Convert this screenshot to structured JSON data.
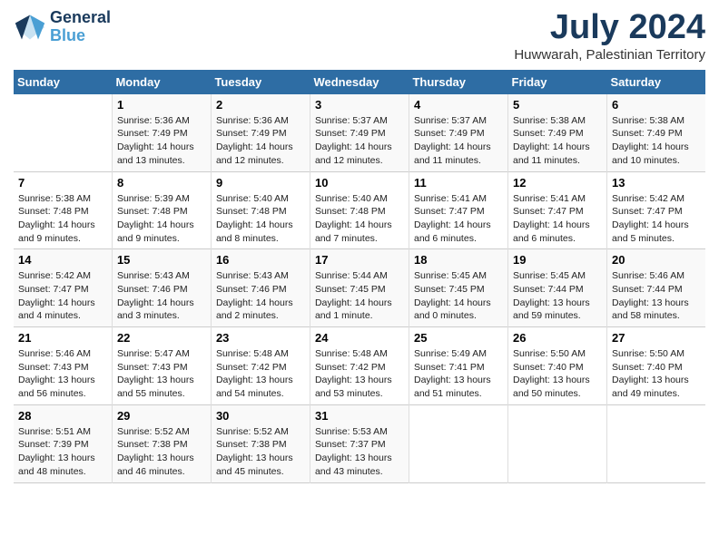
{
  "logo": {
    "text_general": "General",
    "text_blue": "Blue"
  },
  "title": "July 2024",
  "subtitle": "Huwwarah, Palestinian Territory",
  "days_header": [
    "Sunday",
    "Monday",
    "Tuesday",
    "Wednesday",
    "Thursday",
    "Friday",
    "Saturday"
  ],
  "weeks": [
    [
      {
        "day": "",
        "info": ""
      },
      {
        "day": "1",
        "info": "Sunrise: 5:36 AM\nSunset: 7:49 PM\nDaylight: 14 hours\nand 13 minutes."
      },
      {
        "day": "2",
        "info": "Sunrise: 5:36 AM\nSunset: 7:49 PM\nDaylight: 14 hours\nand 12 minutes."
      },
      {
        "day": "3",
        "info": "Sunrise: 5:37 AM\nSunset: 7:49 PM\nDaylight: 14 hours\nand 12 minutes."
      },
      {
        "day": "4",
        "info": "Sunrise: 5:37 AM\nSunset: 7:49 PM\nDaylight: 14 hours\nand 11 minutes."
      },
      {
        "day": "5",
        "info": "Sunrise: 5:38 AM\nSunset: 7:49 PM\nDaylight: 14 hours\nand 11 minutes."
      },
      {
        "day": "6",
        "info": "Sunrise: 5:38 AM\nSunset: 7:49 PM\nDaylight: 14 hours\nand 10 minutes."
      }
    ],
    [
      {
        "day": "7",
        "info": "Sunrise: 5:38 AM\nSunset: 7:48 PM\nDaylight: 14 hours\nand 9 minutes."
      },
      {
        "day": "8",
        "info": "Sunrise: 5:39 AM\nSunset: 7:48 PM\nDaylight: 14 hours\nand 9 minutes."
      },
      {
        "day": "9",
        "info": "Sunrise: 5:40 AM\nSunset: 7:48 PM\nDaylight: 14 hours\nand 8 minutes."
      },
      {
        "day": "10",
        "info": "Sunrise: 5:40 AM\nSunset: 7:48 PM\nDaylight: 14 hours\nand 7 minutes."
      },
      {
        "day": "11",
        "info": "Sunrise: 5:41 AM\nSunset: 7:47 PM\nDaylight: 14 hours\nand 6 minutes."
      },
      {
        "day": "12",
        "info": "Sunrise: 5:41 AM\nSunset: 7:47 PM\nDaylight: 14 hours\nand 6 minutes."
      },
      {
        "day": "13",
        "info": "Sunrise: 5:42 AM\nSunset: 7:47 PM\nDaylight: 14 hours\nand 5 minutes."
      }
    ],
    [
      {
        "day": "14",
        "info": "Sunrise: 5:42 AM\nSunset: 7:47 PM\nDaylight: 14 hours\nand 4 minutes."
      },
      {
        "day": "15",
        "info": "Sunrise: 5:43 AM\nSunset: 7:46 PM\nDaylight: 14 hours\nand 3 minutes."
      },
      {
        "day": "16",
        "info": "Sunrise: 5:43 AM\nSunset: 7:46 PM\nDaylight: 14 hours\nand 2 minutes."
      },
      {
        "day": "17",
        "info": "Sunrise: 5:44 AM\nSunset: 7:45 PM\nDaylight: 14 hours\nand 1 minute."
      },
      {
        "day": "18",
        "info": "Sunrise: 5:45 AM\nSunset: 7:45 PM\nDaylight: 14 hours\nand 0 minutes."
      },
      {
        "day": "19",
        "info": "Sunrise: 5:45 AM\nSunset: 7:44 PM\nDaylight: 13 hours\nand 59 minutes."
      },
      {
        "day": "20",
        "info": "Sunrise: 5:46 AM\nSunset: 7:44 PM\nDaylight: 13 hours\nand 58 minutes."
      }
    ],
    [
      {
        "day": "21",
        "info": "Sunrise: 5:46 AM\nSunset: 7:43 PM\nDaylight: 13 hours\nand 56 minutes."
      },
      {
        "day": "22",
        "info": "Sunrise: 5:47 AM\nSunset: 7:43 PM\nDaylight: 13 hours\nand 55 minutes."
      },
      {
        "day": "23",
        "info": "Sunrise: 5:48 AM\nSunset: 7:42 PM\nDaylight: 13 hours\nand 54 minutes."
      },
      {
        "day": "24",
        "info": "Sunrise: 5:48 AM\nSunset: 7:42 PM\nDaylight: 13 hours\nand 53 minutes."
      },
      {
        "day": "25",
        "info": "Sunrise: 5:49 AM\nSunset: 7:41 PM\nDaylight: 13 hours\nand 51 minutes."
      },
      {
        "day": "26",
        "info": "Sunrise: 5:50 AM\nSunset: 7:40 PM\nDaylight: 13 hours\nand 50 minutes."
      },
      {
        "day": "27",
        "info": "Sunrise: 5:50 AM\nSunset: 7:40 PM\nDaylight: 13 hours\nand 49 minutes."
      }
    ],
    [
      {
        "day": "28",
        "info": "Sunrise: 5:51 AM\nSunset: 7:39 PM\nDaylight: 13 hours\nand 48 minutes."
      },
      {
        "day": "29",
        "info": "Sunrise: 5:52 AM\nSunset: 7:38 PM\nDaylight: 13 hours\nand 46 minutes."
      },
      {
        "day": "30",
        "info": "Sunrise: 5:52 AM\nSunset: 7:38 PM\nDaylight: 13 hours\nand 45 minutes."
      },
      {
        "day": "31",
        "info": "Sunrise: 5:53 AM\nSunset: 7:37 PM\nDaylight: 13 hours\nand 43 minutes."
      },
      {
        "day": "",
        "info": ""
      },
      {
        "day": "",
        "info": ""
      },
      {
        "day": "",
        "info": ""
      }
    ]
  ]
}
